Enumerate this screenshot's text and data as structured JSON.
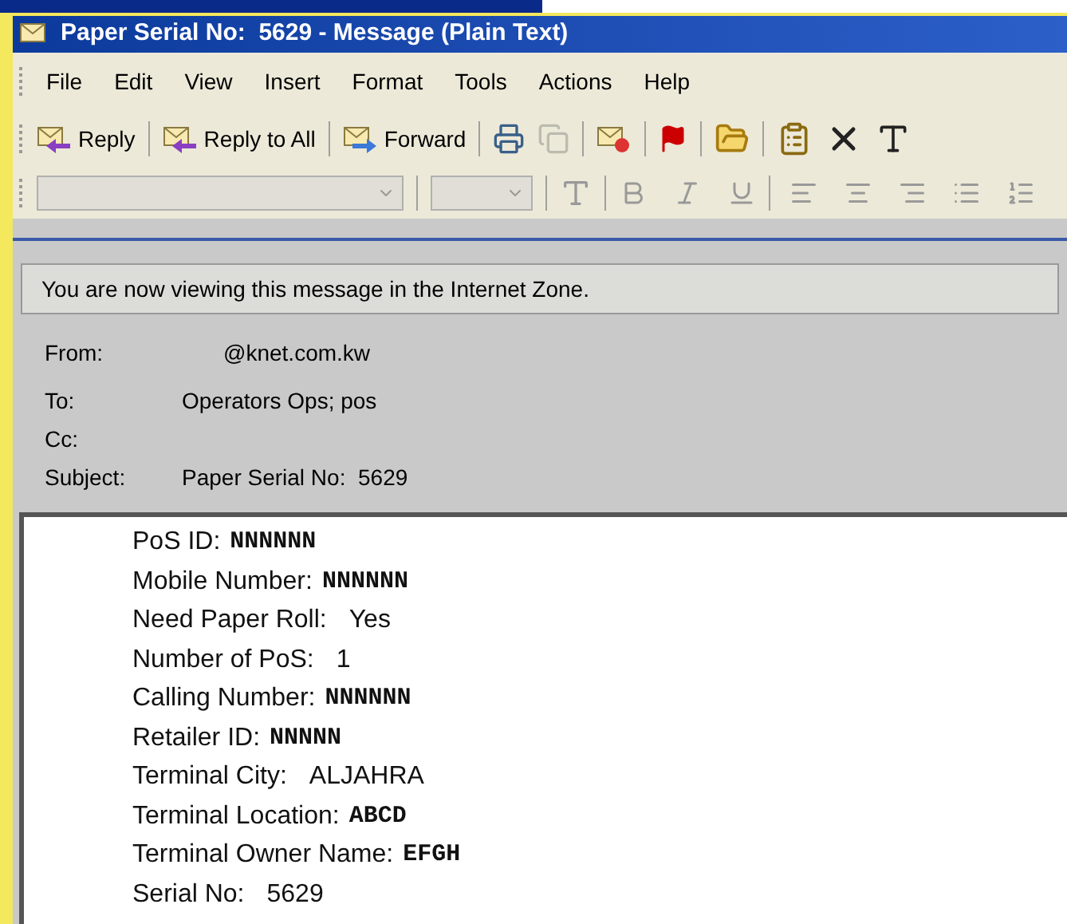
{
  "window": {
    "title": "Paper Serial No:  5629 - Message (Plain Text)"
  },
  "menu": [
    "File",
    "Edit",
    "View",
    "Insert",
    "Format",
    "Tools",
    "Actions",
    "Help"
  ],
  "toolbar": [
    {
      "kind": "reply",
      "label": "Reply",
      "disabled": false
    },
    {
      "kind": "reply_all",
      "label": "Reply to All",
      "disabled": false
    },
    {
      "kind": "forward",
      "label": "Forward",
      "disabled": false
    },
    {
      "kind": "print",
      "disabled": false
    },
    {
      "kind": "copy",
      "disabled": true
    },
    {
      "kind": "junk",
      "disabled": false
    },
    {
      "kind": "flag",
      "disabled": false
    },
    {
      "kind": "folder",
      "disabled": false
    },
    {
      "kind": "move",
      "disabled": false
    },
    {
      "kind": "delete",
      "disabled": false
    },
    {
      "kind": "font_size",
      "disabled": false
    }
  ],
  "info_bar": "You are now viewing this message in the Internet Zone.",
  "headers": [
    {
      "label": "From:",
      "value": "@knet.com.kw",
      "kind": "from"
    },
    {
      "label": "To:",
      "value": "Operators Ops; pos",
      "kind": "plain"
    },
    {
      "label": "Cc:",
      "kind": "plain"
    },
    {
      "label": "Subject:",
      "value": "Paper Serial No:  5629",
      "kind": "plain"
    }
  ],
  "body": [
    {
      "label": "PoS ID:",
      "value": "NNNNNN",
      "kind": "typed"
    },
    {
      "label": "Mobile Number:",
      "value": "NNNNNN",
      "kind": "typed"
    },
    {
      "label": "Need Paper Roll:",
      "value": "Yes",
      "kind": "plain"
    },
    {
      "label": "Number of PoS:",
      "value": "1",
      "kind": "plain"
    },
    {
      "label": "Calling Number:",
      "value": "NNNNNN",
      "kind": "typed"
    },
    {
      "label": "Retailer ID:",
      "value": "NNNNN",
      "kind": "typed"
    },
    {
      "label": "Terminal City:",
      "value": "ALJAHRA",
      "kind": "plain"
    },
    {
      "label": "Terminal Location:",
      "value": "ABCD",
      "kind": "typed"
    },
    {
      "label": "Terminal Owner Name:",
      "value": "EFGH",
      "kind": "typed"
    },
    {
      "label": "Serial No:",
      "value": "5629",
      "kind": "plain"
    }
  ]
}
